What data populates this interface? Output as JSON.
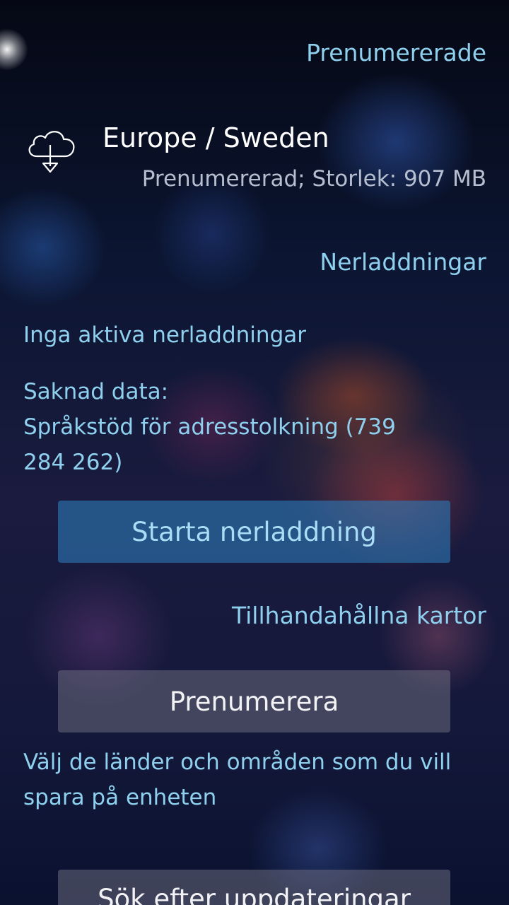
{
  "header": {
    "subscribed_title": "Prenumererade"
  },
  "subscribed_item": {
    "icon": "cloud-download-icon",
    "title": "Europe / Sweden",
    "subtitle": "Prenumererad; Storlek: 907 MB"
  },
  "downloads": {
    "title": "Nerladdningar",
    "status": "Inga aktiva nerladdningar",
    "missing_label": "Saknad data:",
    "missing_item": "Språkstöd för adresstolkning (739 284 262)",
    "start_button": "Starta nerladdning"
  },
  "provided_maps": {
    "title": "Tillhandahållna kartor",
    "subscribe_button": "Prenumerera",
    "description": "Välj de länder och områden som du vill spara på enheten"
  },
  "updates": {
    "check_button": "Sök efter uppdateringar"
  },
  "colors": {
    "accent": "#8fd0ee",
    "highlight_button": "#2d78b4",
    "primary_text": "#ffffff"
  }
}
